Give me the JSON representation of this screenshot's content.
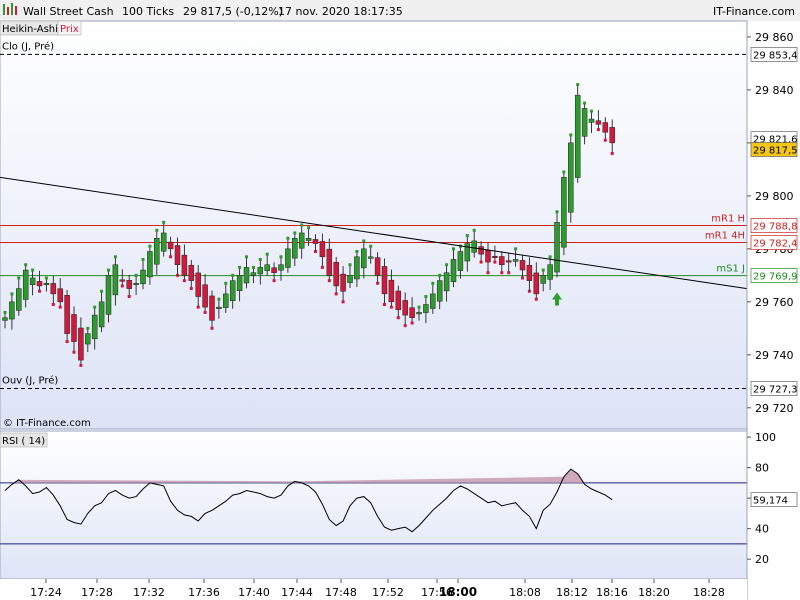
{
  "header": {
    "instrument": "Wall Street Cash",
    "interval": "100 Ticks",
    "quote": "29 817,5 (-0,12%)",
    "datetime": "17 nov. 2020 18:17:35",
    "brand": "IT-Finance.com"
  },
  "toolbar": {
    "chart_type_label": "Heikin-Ashi",
    "price_label": "Prix"
  },
  "copyright": "© IT-Finance.com",
  "colors": {
    "bull": "#2e9a2e",
    "bear": "#d01a3c",
    "resistance": "#cc2222",
    "support": "#228b22",
    "rsi_line": "#000000",
    "rsi_overbought_fill": "#c79bb0",
    "price_tag": "#f5c518"
  },
  "chart_data": [
    {
      "type": "candlestick",
      "variant": "Heikin-Ashi",
      "ylim": [
        29712,
        29866
      ],
      "y_ticks": [
        29720,
        29740,
        29760,
        29780,
        29800,
        29820,
        29840,
        29860
      ],
      "y_tick_labels": [
        "29 720",
        "29 740",
        "29 760",
        "29 780",
        "29 800",
        "29 820",
        "29 840",
        "29 860"
      ],
      "x_tick_labels": [
        "17:24",
        "17:28",
        "17:32",
        "17:36",
        "17:40",
        "17:44",
        "17:48",
        "17:52",
        "17:56",
        "18:00",
        "18:08",
        "18:12",
        "18:16",
        "18:20",
        "18:28"
      ],
      "closes": [
        29754,
        29760,
        29765,
        29772,
        29769,
        29766,
        29767,
        29763,
        29760,
        29748,
        29745,
        29738,
        29748,
        29755,
        29760,
        29770,
        29774,
        29768,
        29765,
        29767,
        29772,
        29779,
        29784,
        29786,
        29780,
        29774,
        29770,
        29768,
        29762,
        29758,
        29753,
        29758,
        29763,
        29768,
        29770,
        29773,
        29771,
        29773,
        29774,
        29771,
        29774,
        29780,
        29784,
        29786,
        29784,
        29782,
        29777,
        29770,
        29766,
        29764,
        29770,
        29777,
        29780,
        29777,
        29770,
        29763,
        29760,
        29757,
        29755,
        29754,
        29756,
        29759,
        29763,
        29768,
        29771,
        29776,
        29779,
        29782,
        29783,
        29778,
        29775,
        29777,
        29774,
        29775,
        29776,
        29772,
        29768,
        29763,
        29770,
        29774,
        29790,
        29807,
        29820,
        29838,
        29833,
        29829,
        29827,
        29824,
        29820
      ],
      "levels": [
        {
          "name": "Clo (J, Pré)",
          "value": 29853.4,
          "value_label": "29 853,4",
          "style": "dashed"
        },
        {
          "name": "mR1 H",
          "value": 29788.8,
          "value_label": "29 788,8",
          "style": "resistance"
        },
        {
          "name": "mR1 4H",
          "value": 29782.4,
          "value_label": "29 782,4",
          "style": "resistance"
        },
        {
          "name": "mS1 J",
          "value": 29769.9,
          "value_label": "29 769,9",
          "style": "support"
        },
        {
          "name": "Ouv (J, Pré)",
          "value": 29727.3,
          "value_label": "29 727,3",
          "style": "dashed"
        }
      ],
      "last_prices": [
        {
          "value": 29821.6,
          "label": "29 821,6",
          "highlight": false
        },
        {
          "value": 29817.5,
          "label": "29 817,5",
          "highlight": true
        }
      ]
    },
    {
      "type": "line",
      "name": "RSI ( 14)",
      "ylim": [
        7,
        104
      ],
      "y_ticks": [
        20,
        40,
        60,
        80,
        100
      ],
      "y_tick_labels": [
        "20",
        "40",
        "60",
        "80",
        "100"
      ],
      "overbought": 70,
      "oversold": 30,
      "last_value_label": "59,174",
      "values": [
        65,
        69,
        72,
        68,
        63,
        64,
        67,
        62,
        55,
        46,
        44,
        43,
        50,
        55,
        57,
        63,
        65,
        62,
        60,
        61,
        66,
        70,
        69,
        68,
        58,
        52,
        49,
        48,
        45,
        50,
        52,
        55,
        58,
        62,
        63,
        65,
        64,
        63,
        61,
        60,
        62,
        68,
        71,
        70,
        68,
        64,
        56,
        46,
        42,
        45,
        55,
        60,
        61,
        57,
        48,
        41,
        39,
        40,
        41,
        38,
        42,
        47,
        52,
        56,
        60,
        65,
        68,
        66,
        63,
        60,
        57,
        58,
        55,
        56,
        57,
        52,
        48,
        40,
        52,
        56,
        64,
        74,
        79,
        76,
        69,
        66,
        64,
        62,
        59
      ]
    }
  ]
}
